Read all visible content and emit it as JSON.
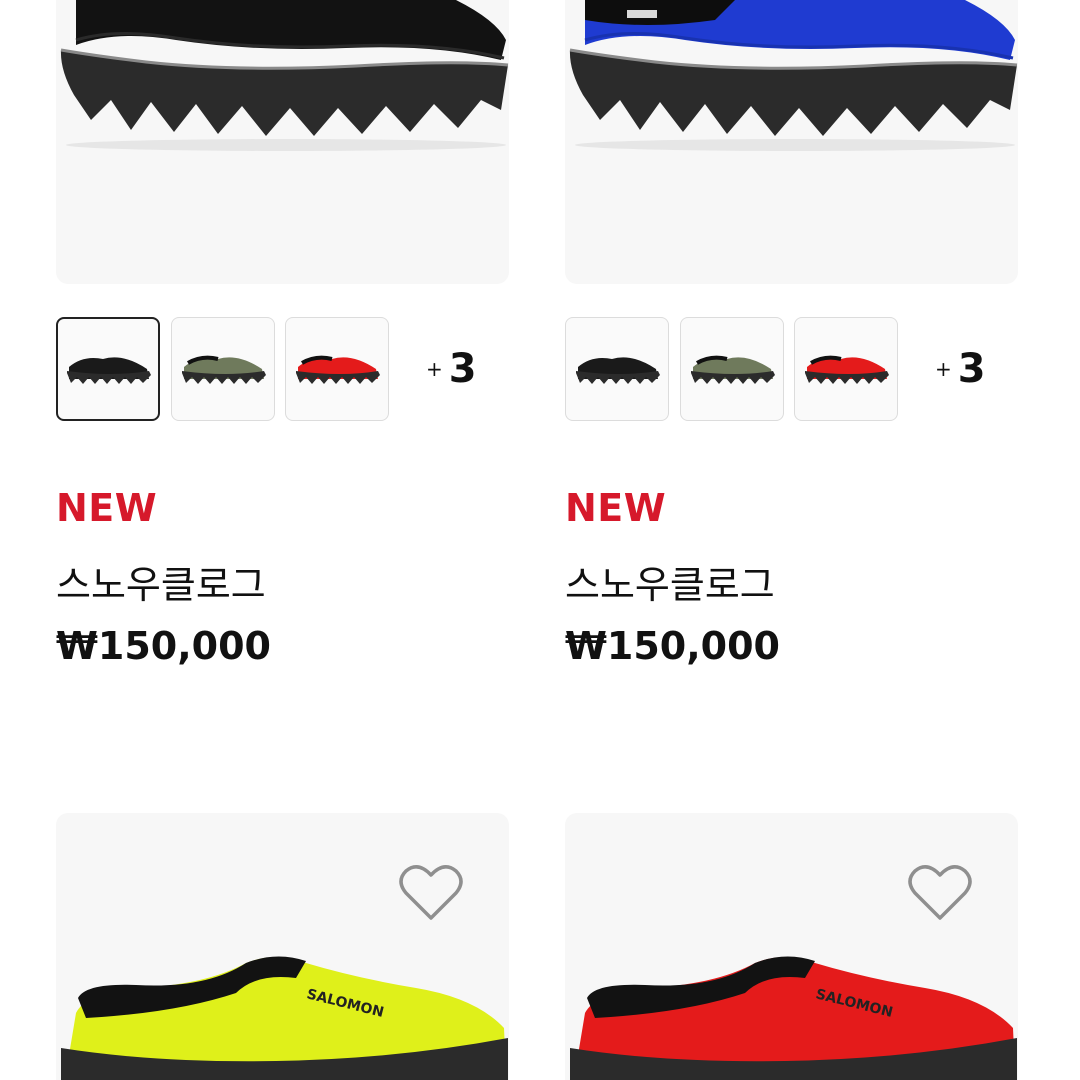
{
  "products": [
    {
      "badge": "NEW",
      "name": "스노우클로그",
      "price": "₩150,000",
      "color": "#111111",
      "more_colors": "3",
      "swatches": [
        "#1a1a1a",
        "#6f7a5c",
        "#e41b1b"
      ]
    },
    {
      "badge": "NEW",
      "name": "스노우클로그",
      "price": "₩150,000",
      "color": "#1f3bd1",
      "more_colors": "3",
      "swatches": [
        "#1a1a1a",
        "#6f7a5c",
        "#e41b1b"
      ]
    },
    {
      "color": "#dff01a",
      "heart_icon": "heart-outline-icon"
    },
    {
      "color": "#e41b1b",
      "heart_icon": "heart-outline-icon"
    }
  ],
  "more_prefix": "+",
  "brand_print": "SALOMON"
}
